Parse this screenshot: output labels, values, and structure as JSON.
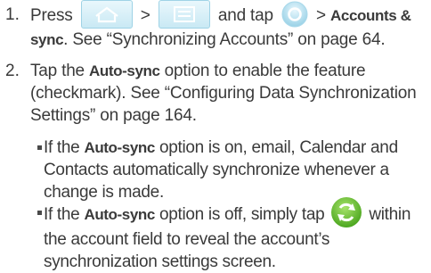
{
  "steps": [
    {
      "number": "1.",
      "text_1": "Press",
      "sep_1": ">",
      "text_2": "and tap",
      "sep_2": ">",
      "bold_1": "Accounts & sync",
      "text_3": ". See “Synchronizing Accounts” on page 64."
    },
    {
      "number": "2.",
      "text_1": "Tap the",
      "bold_1": "Auto-sync",
      "text_2": "option to enable the feature (checkmark). See “Configuring Data Synchronization Settings” on page 164."
    }
  ],
  "bullets": [
    {
      "text_1": "If the",
      "bold_1": "Auto-sync",
      "text_2": "option is on, email, Calendar and Contacts automatically synchronize whenever a change is made."
    },
    {
      "text_1": "If the",
      "bold_1": "Auto-sync",
      "text_2": "option is off, simply tap",
      "text_3": "within the account field to reveal the account’s synchronization settings screen."
    }
  ],
  "icons": {
    "home": "home-icon",
    "menu": "menu-icon",
    "settings": "settings-icon",
    "sync": "sync-icon"
  },
  "colors": {
    "text": "#3a3a3a",
    "icon_blue": "#9fd3e6",
    "sync_green": "#6cc23a"
  }
}
